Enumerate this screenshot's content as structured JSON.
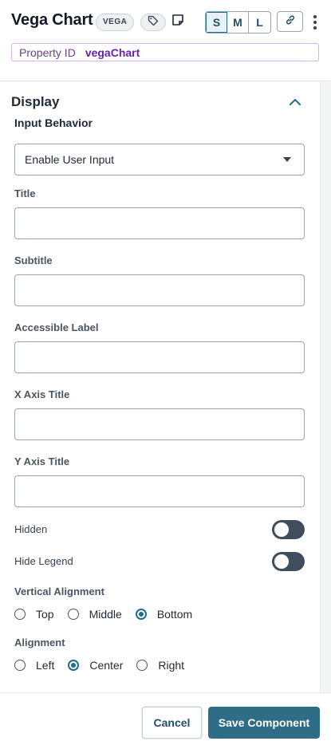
{
  "header": {
    "title": "Vega Chart",
    "badge": "VEGA",
    "tag_icon": "tag-icon",
    "note_icon": "note-icon",
    "sizes": [
      "S",
      "M",
      "L"
    ],
    "active_size": "S",
    "link_icon": "link-icon",
    "menu_icon": "kebab-menu-icon"
  },
  "property_id": {
    "label": "Property ID",
    "value": "vegaChart"
  },
  "section": {
    "title": "Display",
    "collapse_icon": "chevron-up-icon"
  },
  "fields": {
    "input_behavior": {
      "label": "Input Behavior",
      "value": "Enable User Input"
    },
    "title": {
      "label": "Title",
      "value": ""
    },
    "subtitle": {
      "label": "Subtitle",
      "value": ""
    },
    "accessible_label": {
      "label": "Accessible Label",
      "value": ""
    },
    "x_axis_title": {
      "label": "X Axis Title",
      "value": ""
    },
    "y_axis_title": {
      "label": "Y Axis Title",
      "value": ""
    }
  },
  "toggles": {
    "hidden": {
      "label": "Hidden",
      "on": false
    },
    "hide_legend": {
      "label": "Hide Legend",
      "on": false
    }
  },
  "vertical_alignment": {
    "label": "Vertical Alignment",
    "options": [
      "Top",
      "Middle",
      "Bottom"
    ],
    "selected": "Bottom"
  },
  "alignment": {
    "label": "Alignment",
    "options": [
      "Left",
      "Center",
      "Right"
    ],
    "selected": "Center"
  },
  "footer": {
    "cancel": "Cancel",
    "save": "Save Component"
  },
  "colors": {
    "accent": "#2f6d86",
    "toggle_off": "#3f4e5c",
    "property_purple": "#6b21a8"
  }
}
